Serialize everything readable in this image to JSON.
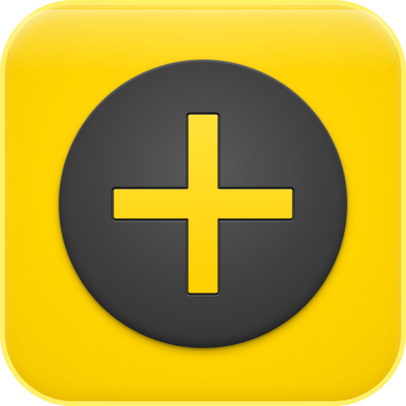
{
  "icon": {
    "name": "plus-icon",
    "tile_color": "#ffd400",
    "button_color": "#404040",
    "plus_color": "#ffd800"
  }
}
